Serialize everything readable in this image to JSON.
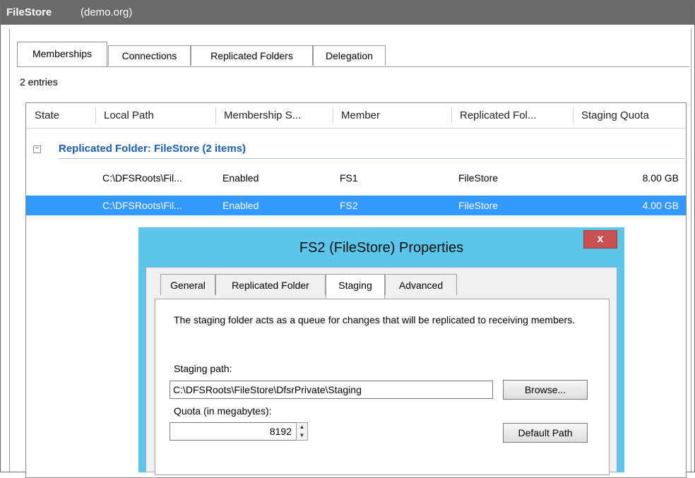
{
  "window": {
    "app_title": "FileStore",
    "namespace": "(demo.org)"
  },
  "tabs": [
    "Memberships",
    "Connections",
    "Replicated Folders",
    "Delegation"
  ],
  "entries_count": "2 entries",
  "columns": [
    "State",
    "Local Path",
    "Membership S...",
    "Member",
    "Replicated Fol...",
    "Staging Quota"
  ],
  "group": {
    "expander": "−",
    "title": "Replicated Folder: FileStore (2 items)"
  },
  "rows": [
    {
      "state": "",
      "local_path": "C:\\DFSRoots\\Fil...",
      "membership": "Enabled",
      "member": "FS1",
      "replicated_folder": "FileStore",
      "quota": "8.00 GB",
      "selected": false
    },
    {
      "state": "",
      "local_path": "C:\\DFSRoots\\Fil...",
      "membership": "Enabled",
      "member": "FS2",
      "replicated_folder": "FileStore",
      "quota": "4.00 GB",
      "selected": true
    }
  ],
  "dialog": {
    "title": "FS2 (FileStore) Properties",
    "close": "x",
    "tabs": [
      "General",
      "Replicated Folder",
      "Staging",
      "Advanced"
    ],
    "active_tab": "Staging",
    "description": "The staging folder acts as a queue for changes that will be replicated to receiving members.",
    "staging_path_label": "Staging path:",
    "staging_path_value": "C:\\DFSRoots\\FileStore\\DfsrPrivate\\Staging",
    "browse_label": "Browse...",
    "quota_label": "Quota (in megabytes):",
    "quota_value": "8192",
    "default_path_label": "Default Path",
    "spin_up": "▲",
    "spin_down": "▼"
  },
  "colors": {
    "titlebar": "#6b6b6b",
    "selection": "#3399ff",
    "group_title": "#1a5fb4",
    "dialog_chrome": "#5cc5e9",
    "close_button": "#c75050"
  }
}
